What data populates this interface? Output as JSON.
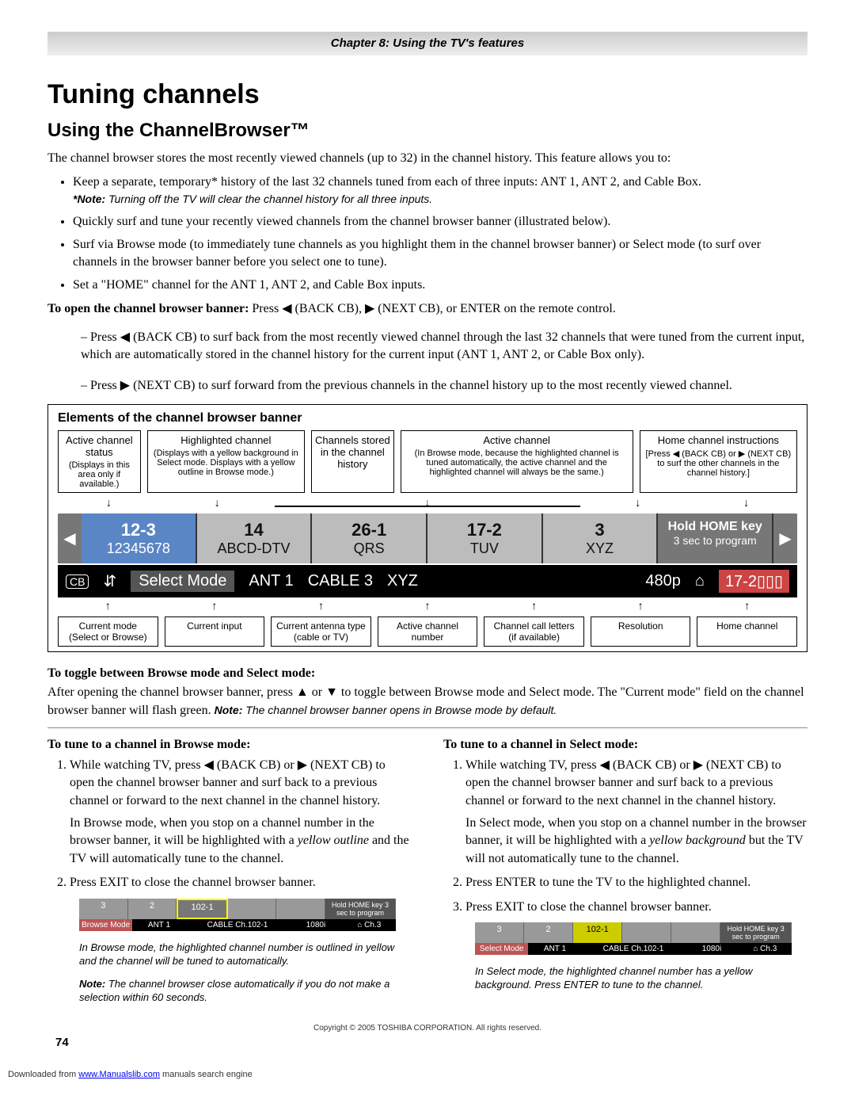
{
  "chapter_bar": "Chapter 8: Using the TV's features",
  "h1": "Tuning channels",
  "h2": "Using the ChannelBrowser™",
  "intro": "The channel browser stores the most recently viewed channels (up to 32) in the channel history. This feature allows you to:",
  "bullets": [
    "Keep a separate, temporary* history of the last 32 channels tuned from each of three inputs: ANT 1, ANT 2, and Cable Box.",
    "Quickly surf and tune your recently viewed channels from the channel browser banner (illustrated below).",
    "Surf via Browse mode (to immediately tune channels as you highlight them in the channel browser banner) or Select mode (to surf over channels in the browser banner before you select one to tune).",
    "Set a \"HOME\" channel for the ANT 1, ANT 2, and Cable Box inputs."
  ],
  "note1_label": "*Note:",
  "note1": "Turning off the TV will clear the channel history for all three inputs.",
  "open_line_pre": "To open the channel browser banner:",
  "open_line_post": " Press ◀ (BACK CB), ▶ (NEXT CB), or ENTER on the remote control.",
  "dash1": "– Press ◀ (BACK CB) to surf back from the most recently viewed channel through the last 32 channels that were tuned from the current input, which are automatically stored in the channel history for the current input (ANT 1, ANT 2, or Cable Box only).",
  "dash2": "– Press ▶ (NEXT CB) to surf forward from the previous channels in the channel history up to the most recently viewed channel.",
  "diagram_title": "Elements of the channel browser banner",
  "top_labels": [
    {
      "h": "Active channel status",
      "s": "(Displays in this area only if available.)"
    },
    {
      "h": "Highlighted channel",
      "s": "(Displays with a yellow background in Select mode. Displays with a yellow outline in Browse mode.)"
    },
    {
      "h": "Channels stored in the channel history",
      "s": ""
    },
    {
      "h": "Active channel",
      "s": "(In Browse mode, because the highlighted channel is tuned automatically, the active channel and the highlighted channel will always be the same.)"
    },
    {
      "h": "Home channel instructions",
      "s": "[Press ◀ (BACK CB) or ▶ (NEXT CB) to surf the other channels in the channel history.]"
    }
  ],
  "banner_slots": [
    {
      "big": "12-3",
      "sub": "12345678",
      "cls": "active"
    },
    {
      "big": "14",
      "sub": "ABCD-DTV",
      "cls": ""
    },
    {
      "big": "26-1",
      "sub": "QRS",
      "cls": ""
    },
    {
      "big": "17-2",
      "sub": "TUV",
      "cls": ""
    },
    {
      "big": "3",
      "sub": "XYZ",
      "cls": ""
    },
    {
      "big": "Hold HOME key",
      "sub": "3 sec to program",
      "cls": "right"
    }
  ],
  "status": {
    "mode": "Select Mode",
    "input": "ANT 1",
    "ant": "CABLE 3",
    "ch": "XYZ",
    "res": "480p",
    "home": "17-2"
  },
  "bot_labels": [
    {
      "h": "Current mode",
      "s": "(Select or Browse)"
    },
    {
      "h": "Current input",
      "s": ""
    },
    {
      "h": "Current antenna type",
      "s": "(cable or TV)"
    },
    {
      "h": "Active channel number",
      "s": ""
    },
    {
      "h": "Channel call letters",
      "s": "(if available)"
    },
    {
      "h": "Resolution",
      "s": ""
    },
    {
      "h": "Home channel",
      "s": ""
    }
  ],
  "toggle_h": "To toggle between Browse mode and Select mode:",
  "toggle_p": "After opening the channel browser banner, press ▲ or ▼ to toggle between Browse mode and Select mode.  The \"Current mode\" field on the channel browser banner will flash green.  ",
  "toggle_note_label": "Note:",
  "toggle_note": " The channel browser banner opens in Browse mode by default.",
  "col1_h": "To tune to a channel in Browse mode:",
  "col1_li1": "While watching TV, press ◀ (BACK CB) or ▶ (NEXT CB)  to open the channel browser banner and surf back to a previous channel or forward to the next channel in the channel history.",
  "col1_li1_p": "In Browse mode, when you stop on a channel number in the browser banner, it will be highlighted with a ",
  "col1_li1_em": "yellow outline",
  "col1_li1_end": " and the TV will automatically tune to the channel.",
  "col1_li2": "Press EXIT to close the channel browser banner.",
  "mini1": {
    "cells": [
      "3",
      "2",
      "102-1",
      "",
      "",
      "Hold HOME key 3 sec to program"
    ],
    "hl_index": 2,
    "hl_style": "outline",
    "mode": "Browse Mode",
    "input": "ANT 1",
    "ant": "CABLE  Ch.102-1",
    "res": "1080i",
    "home": "⌂ Ch.3"
  },
  "col1_cap1": "In Browse mode, the highlighted channel number is outlined in yellow and the channel will be tuned to automatically.",
  "col1_cap2_label": "Note:",
  "col1_cap2": " The channel browser close automatically if you do not make a selection within 60 seconds.",
  "col2_h": "To tune to a channel in Select mode:",
  "col2_li1": "While watching TV, press ◀ (BACK CB) or ▶ (NEXT CB)  to open the channel browser banner and surf back to a previous channel or forward to the next channel in the channel history.",
  "col2_li1_p": "In Select mode, when you stop on a channel number in the browser banner, it will be highlighted with a ",
  "col2_li1_em": "yellow background",
  "col2_li1_end": " but the TV will not automatically tune to the channel.",
  "col2_li2": "Press ENTER to tune the TV to the highlighted channel.",
  "col2_li3": "Press EXIT to close the channel browser banner.",
  "mini2": {
    "cells": [
      "3",
      "2",
      "102-1",
      "",
      "",
      "Hold HOME key 3 sec to program"
    ],
    "hl_index": 2,
    "hl_style": "bg",
    "mode": "Select Mode",
    "input": "ANT 1",
    "ant": "CABLE  Ch.102-1",
    "res": "1080i",
    "home": "⌂ Ch.3"
  },
  "col2_cap": "In Select mode, the highlighted channel number has a yellow background. Press ENTER to tune to the channel.",
  "copyright": "Copyright © 2005 TOSHIBA CORPORATION. All rights reserved.",
  "page_num": "74",
  "download_pre": "Downloaded from ",
  "download_link": "www.Manualslib.com",
  "download_post": " manuals search engine"
}
